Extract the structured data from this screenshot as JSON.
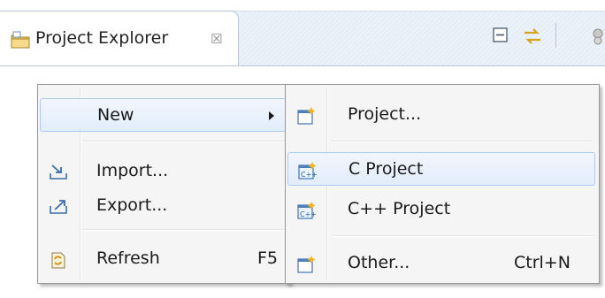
{
  "view": {
    "title": "Project Explorer",
    "close_glyph": "☒",
    "icons": [
      "folder-icon",
      "collapse-all-icon",
      "link-with-editor-icon",
      "view-menu-icon"
    ]
  },
  "context_menu": {
    "items": [
      {
        "label": "New",
        "icon": "none",
        "submenu": true,
        "accelerator": ""
      },
      {
        "label": "Import...",
        "icon": "import-icon",
        "accelerator": ""
      },
      {
        "label": "Export...",
        "icon": "export-icon",
        "accelerator": ""
      },
      {
        "label": "Refresh",
        "icon": "refresh-icon",
        "accelerator": "F5"
      }
    ]
  },
  "submenu": {
    "items": [
      {
        "label": "Project...",
        "icon": "new-project-icon",
        "accelerator": ""
      },
      {
        "label": "C Project",
        "icon": "c-project-icon",
        "accelerator": "",
        "highlighted": true
      },
      {
        "label": "C++ Project",
        "icon": "cpp-project-icon",
        "accelerator": ""
      },
      {
        "label": "Other...",
        "icon": "new-wizard-icon",
        "accelerator": "Ctrl+N"
      }
    ]
  },
  "colors": {
    "highlight_border": "#aeccf2",
    "menu_background": "#f5f5f5",
    "view_border": "#b8c6d9"
  }
}
